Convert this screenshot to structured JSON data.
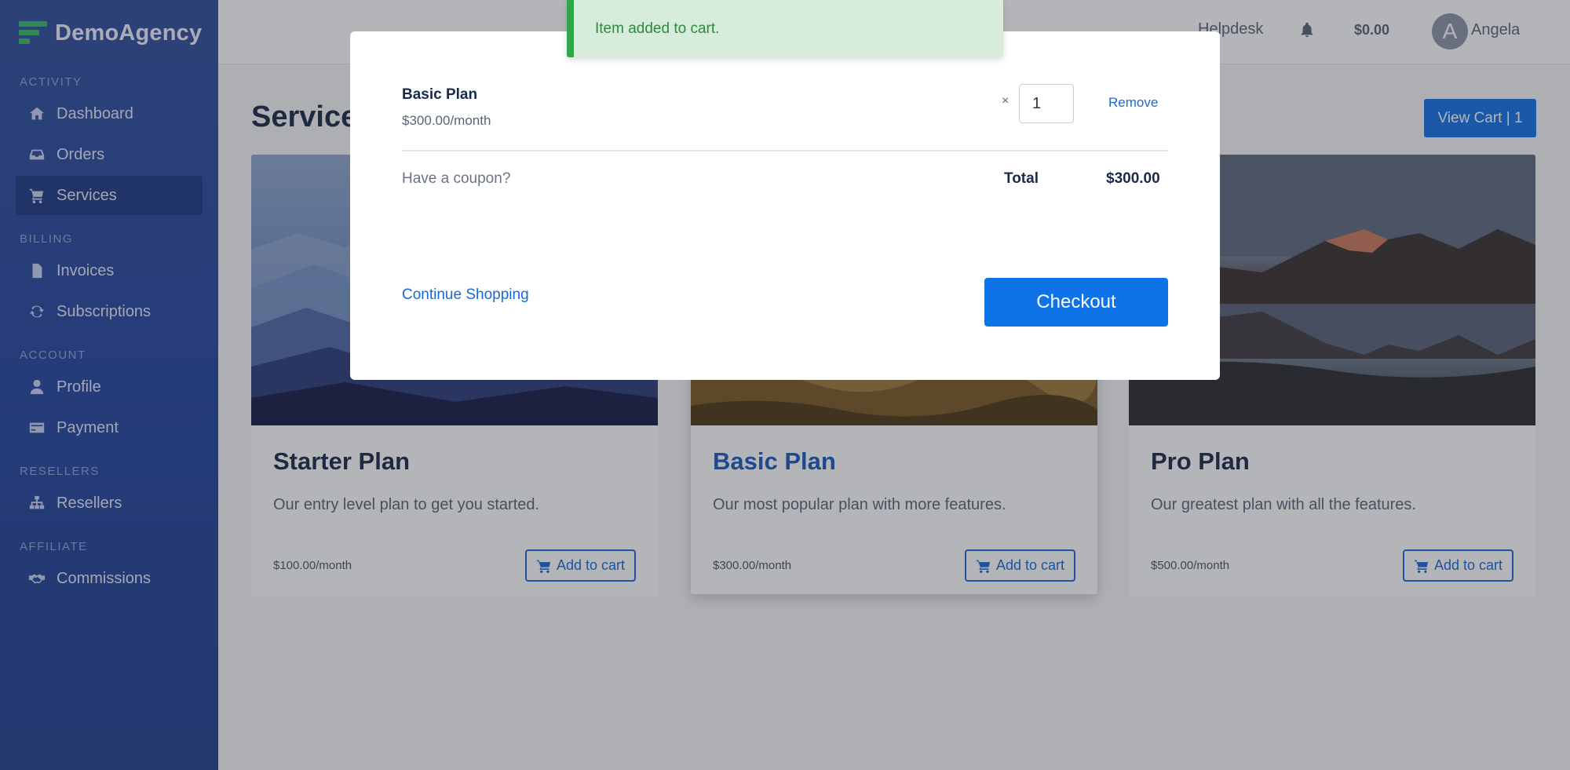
{
  "app": {
    "logo_text": "DemoAgency"
  },
  "sidebar": {
    "sections": [
      {
        "label": "ACTIVITY"
      },
      {
        "label": "BILLING"
      },
      {
        "label": "ACCOUNT"
      },
      {
        "label": "RESELLERS"
      },
      {
        "label": "AFFILIATE"
      }
    ],
    "items": [
      {
        "label": "Dashboard",
        "icon": "home-icon"
      },
      {
        "label": "Orders",
        "icon": "inbox-icon"
      },
      {
        "label": "Services",
        "icon": "cart-icon",
        "active": true
      },
      {
        "label": "Invoices",
        "icon": "file-icon"
      },
      {
        "label": "Subscriptions",
        "icon": "sync-icon"
      },
      {
        "label": "Profile",
        "icon": "user-icon"
      },
      {
        "label": "Payment",
        "icon": "credit-card-icon"
      },
      {
        "label": "Resellers",
        "icon": "sitemap-icon"
      },
      {
        "label": "Commissions",
        "icon": "handshake-icon"
      }
    ]
  },
  "topbar": {
    "helpdesk": "Helpdesk",
    "balance": "$0.00",
    "avatar_initial": "A",
    "username": "Angela"
  },
  "main": {
    "title": "Services",
    "view_cart_label": "View Cart | 1",
    "cards": [
      {
        "title": "Starter Plan",
        "description": "Our entry level plan to get you started.",
        "price": "$100.00/month",
        "button": "Add to cart"
      },
      {
        "title": "Basic Plan",
        "description": "Our most popular plan with more features.",
        "price": "$300.00/month",
        "button": "Add to cart"
      },
      {
        "title": "Pro Plan",
        "description": "Our greatest plan with all the features.",
        "price": "$500.00/month",
        "button": "Add to cart"
      }
    ]
  },
  "modal": {
    "item_name": "Basic Plan",
    "item_price": "$300.00/month",
    "times": "×",
    "quantity": "1",
    "remove_label": "Remove",
    "coupon_label": "Have a coupon?",
    "total_label": "Total",
    "total_value": "$300.00",
    "continue_label": "Continue Shopping",
    "checkout_label": "Checkout"
  },
  "toast": {
    "message": "Item added to cart."
  },
  "colors": {
    "accent": "#1670e6",
    "sidebar": "#2a4a9e",
    "success": "#2fa84a"
  }
}
